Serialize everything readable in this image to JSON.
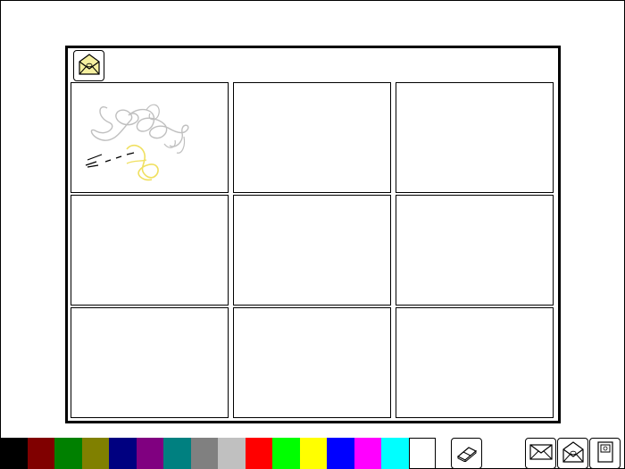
{
  "icons": {
    "open_envelope": "open-envelope-icon",
    "eraser": "eraser-icon",
    "envelope": "envelope-icon",
    "envelope_open_small": "open-envelope-icon",
    "page": "page-icon"
  },
  "gallery": {
    "tiles": [
      {
        "id": 1,
        "has_drawing": true
      },
      {
        "id": 2,
        "has_drawing": false
      },
      {
        "id": 3,
        "has_drawing": false
      },
      {
        "id": 4,
        "has_drawing": false
      },
      {
        "id": 5,
        "has_drawing": false
      },
      {
        "id": 6,
        "has_drawing": false
      },
      {
        "id": 7,
        "has_drawing": false
      },
      {
        "id": 8,
        "has_drawing": false
      },
      {
        "id": 9,
        "has_drawing": false
      }
    ]
  },
  "palette": {
    "colors": [
      "#000000",
      "#800000",
      "#008000",
      "#808000",
      "#000080",
      "#800080",
      "#008080",
      "#808080",
      "#c0c0c0",
      "#ff0000",
      "#00ff00",
      "#ffff00",
      "#0000ff",
      "#ff00ff",
      "#00ffff",
      "#ffffff"
    ]
  },
  "colors": {
    "envelope_fill": "#f5f0a0",
    "scribble_gray": "#bfbfbf",
    "scribble_yellow": "#f0e060"
  }
}
